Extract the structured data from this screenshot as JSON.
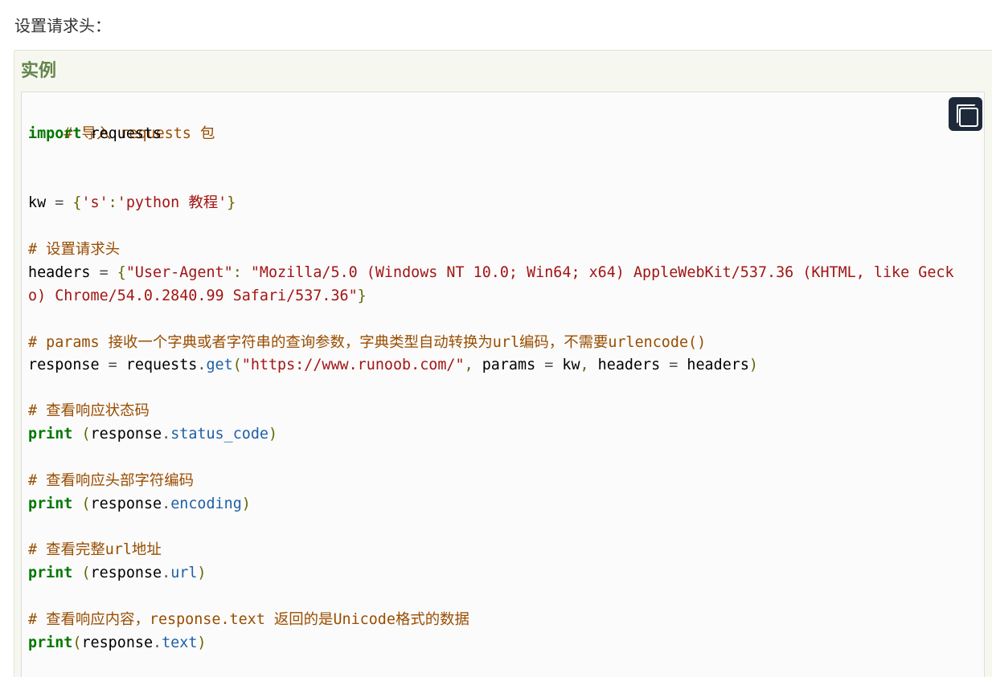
{
  "section_heading": "设置请求头：",
  "example_title": "实例",
  "copy_button": {
    "icon": "copy-icon"
  },
  "colors": {
    "example_bg": "#f6f8ef",
    "example_title": "#64854c",
    "code_bg": "#fbfbfb",
    "comment": "#994d00",
    "keyword": "#007700",
    "string": "#a31515",
    "attribute": "#1f5fa6",
    "copy_button_bg": "#1e2a3a"
  },
  "code": {
    "l1_comment": "# 导入 requests 包",
    "l2_keyword": "import",
    "l2_rest": " requests",
    "l3_name": "kw",
    "l3_op": " = ",
    "l3_open": "{",
    "l3_key": "'s'",
    "l3_colon": ":",
    "l3_value": "'python 教程'",
    "l3_close": "}",
    "l4_comment": "# 设置请求头",
    "l5_name": "headers",
    "l5_op": " = ",
    "l5_open": "{",
    "l5_key": "\"User-Agent\"",
    "l5_colon": ": ",
    "l5_value_part1": "\"Mozilla/5.0 (Windows NT 10.0; Win64; x64) AppleWebKit/537.36 (KHTML, like Geck",
    "l6_value_part2": "o) Chrome/54.0.2840.99 Safari/537.36\"",
    "l6_close": "}",
    "l7_comment": "# params 接收一个字典或者字符串的查询参数，字典类型自动转换为url编码，不需要urlencode()",
    "l8_name": "response",
    "l8_op": " = ",
    "l8_obj": "requests",
    "l8_dot": ".",
    "l8_method": "get",
    "l8_open": "(",
    "l8_url": "\"https://www.runoob.com/\"",
    "l8_comma1": ",",
    "l8_param1": " params",
    "l8_op2": " = ",
    "l8_kw": "kw",
    "l8_comma2": ",",
    "l8_param2": " headers",
    "l8_op3": " = ",
    "l8_headers": "headers",
    "l8_close": ")",
    "l9_comment": "# 查看响应状态码",
    "l10_keyword": "print",
    "l10_open": " (",
    "l10_obj": "response",
    "l10_dot": ".",
    "l10_attr": "status_code",
    "l10_close": ")",
    "l11_comment": "# 查看响应头部字符编码",
    "l12_keyword": "print",
    "l12_open": " (",
    "l12_obj": "response",
    "l12_dot": ".",
    "l12_attr": "encoding",
    "l12_close": ")",
    "l13_comment": "# 查看完整url地址",
    "l14_keyword": "print",
    "l14_open": " (",
    "l14_obj": "response",
    "l14_dot": ".",
    "l14_attr": "url",
    "l14_close": ")",
    "l15_comment": "# 查看响应内容，response.text 返回的是Unicode格式的数据",
    "l16_keyword": "print",
    "l16_open": "(",
    "l16_obj": "response",
    "l16_dot": ".",
    "l16_attr": "text",
    "l16_close": ")"
  }
}
